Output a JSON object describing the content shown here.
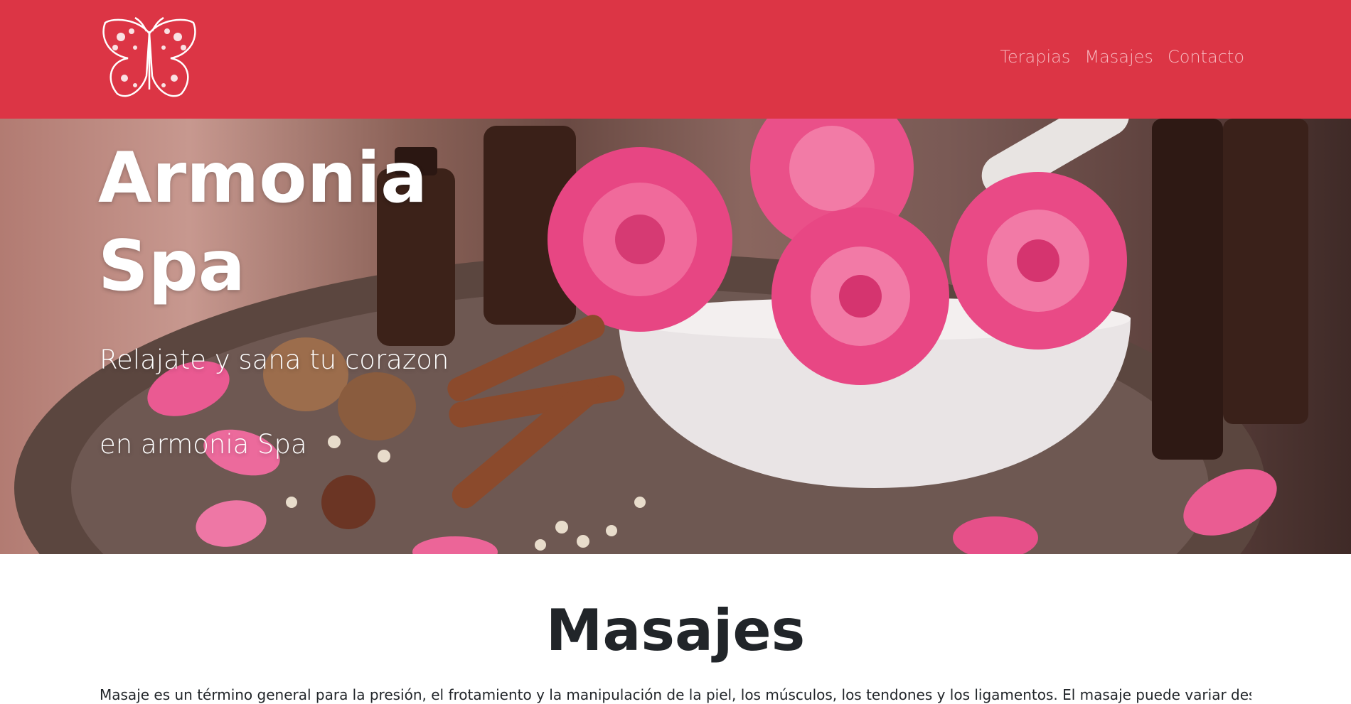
{
  "navbar": {
    "logo_name": "butterfly-logo",
    "links": [
      {
        "label": "Terapias"
      },
      {
        "label": "Masajes"
      },
      {
        "label": "Contacto"
      }
    ]
  },
  "hero": {
    "title": "Armonia Spa",
    "subtitle_line1": "Relajate y sana tu corazon",
    "subtitle_line2": "en armonia Spa"
  },
  "section": {
    "title": "Masajes",
    "text": "Masaje es un término general para la presión, el frotamiento y la manipulación de la piel, los músculos, los tendones y los ligamentos. El masaje puede variar desde una caricia"
  },
  "colors": {
    "navbar_bg": "#dc3545",
    "nav_link": "#f7b9bf",
    "rose": "#ec4f86"
  }
}
